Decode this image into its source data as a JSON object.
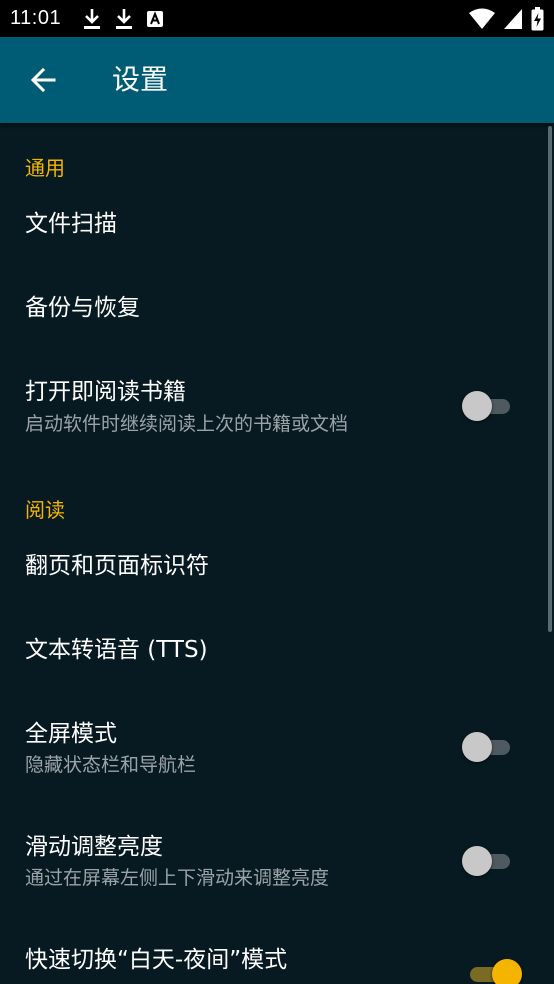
{
  "status_bar": {
    "time": "11:01",
    "icons_left": [
      "download-icon",
      "download-icon",
      "font-icon"
    ],
    "icons_right": [
      "wifi-icon",
      "signal-icon",
      "battery-charging-icon"
    ]
  },
  "app_bar": {
    "back_icon": "arrow-back-icon",
    "title": "设置",
    "color": "#005c74"
  },
  "sections": {
    "general": {
      "header": "通用",
      "file_scan": {
        "title": "文件扫描"
      },
      "backup": {
        "title": "备份与恢复"
      },
      "open_book": {
        "title": "打开即阅读书籍",
        "summary": "启动软件时继续阅读上次的书籍或文档",
        "enabled": false
      }
    },
    "reading": {
      "header": "阅读",
      "page_turn": {
        "title": "翻页和页面标识符"
      },
      "tts": {
        "title": "文本转语音 (TTS)"
      },
      "fullscreen": {
        "title": "全屏模式",
        "summary": "隐藏状态栏和导航栏",
        "enabled": false
      },
      "brightness": {
        "title": "滑动调整亮度",
        "summary": "通过在屏幕左侧上下滑动来调整亮度",
        "enabled": false
      },
      "day_night": {
        "title": "快速切换“白天-夜间”模式",
        "enabled": true
      }
    }
  },
  "colors": {
    "background": "#071a21",
    "accent": "#f5b400",
    "summary_text": "#9aa3a8"
  }
}
